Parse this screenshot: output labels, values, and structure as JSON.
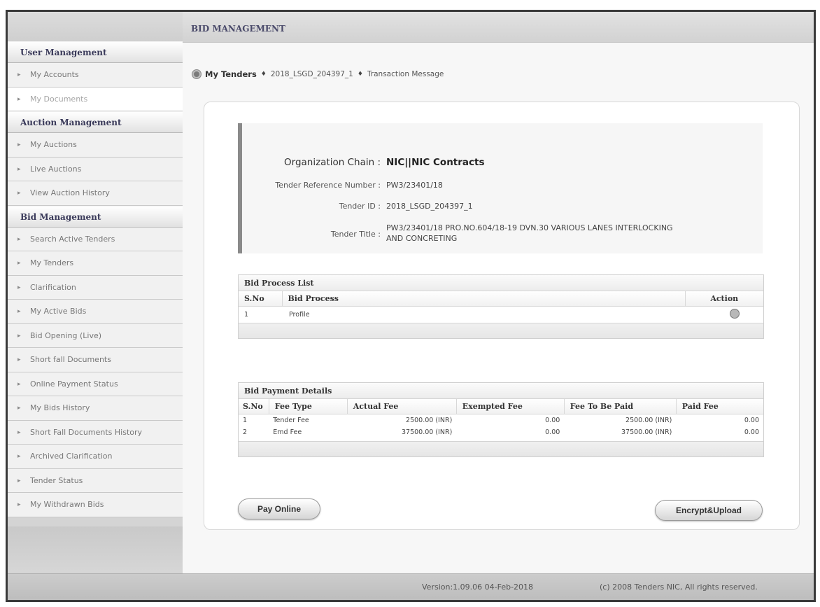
{
  "header": {
    "title": "BID MANAGEMENT"
  },
  "breadcrumb": {
    "home_icon": "home-circle-icon",
    "items": [
      "My Tenders",
      "2018_LSGD_204397_1",
      "Transaction Message"
    ],
    "separator": "♦"
  },
  "sidebar": {
    "sections": [
      {
        "title": "User Management",
        "items": [
          {
            "label": "My Accounts",
            "active": false
          },
          {
            "label": "My Documents",
            "active": true
          }
        ]
      },
      {
        "title": "Auction Management",
        "items": [
          {
            "label": "My Auctions"
          },
          {
            "label": "Live Auctions"
          },
          {
            "label": "View Auction History"
          }
        ]
      },
      {
        "title": "Bid Management",
        "items": [
          {
            "label": "Search Active Tenders"
          },
          {
            "label": "My Tenders"
          },
          {
            "label": "Clarification"
          },
          {
            "label": "My Active Bids"
          },
          {
            "label": "Bid Opening (Live)"
          },
          {
            "label": "Short fall Documents"
          },
          {
            "label": "Online Payment Status"
          },
          {
            "label": "My Bids History"
          },
          {
            "label": "Short Fall Documents History"
          },
          {
            "label": "Archived Clarification"
          },
          {
            "label": "Tender Status"
          },
          {
            "label": "My Withdrawn Bids"
          }
        ]
      }
    ]
  },
  "tender_info": {
    "org_label": "Organization Chain :",
    "org_value": "NIC||NIC Contracts",
    "ref_label": "Tender Reference Number :",
    "ref_value": "PW3/23401/18",
    "id_label": "Tender ID :",
    "id_value": "2018_LSGD_204397_1",
    "title_label": "Tender Title :",
    "title_value": "PW3/23401/18 PRO.NO.604/18-19 DVN.30 VARIOUS LANES INTERLOCKING AND CONCRETING"
  },
  "bid_process": {
    "title": "Bid Process List",
    "columns": [
      "S.No",
      "Bid Process",
      "Action"
    ],
    "rows": [
      {
        "sno": "1",
        "process": "Profile",
        "action_icon": "edit-action-icon"
      }
    ]
  },
  "bid_payment": {
    "title": "Bid Payment Details",
    "columns": [
      "S.No",
      "Fee Type",
      "Actual Fee",
      "Exempted Fee",
      "Fee To Be Paid",
      "Paid Fee"
    ],
    "rows": [
      {
        "sno": "1",
        "fee_type": "Tender Fee",
        "actual": "2500.00 (INR)",
        "exempted": "0.00",
        "to_pay": "2500.00 (INR)",
        "paid": "0.00"
      },
      {
        "sno": "2",
        "fee_type": "Emd Fee",
        "actual": "37500.00 (INR)",
        "exempted": "0.00",
        "to_pay": "37500.00 (INR)",
        "paid": "0.00"
      }
    ]
  },
  "buttons": {
    "pay_online": "Pay Online",
    "encrypt_upload": "Encrypt&Upload"
  },
  "footer": {
    "version": "Version:1.09.06 04-Feb-2018",
    "copyright": "(c) 2008 Tenders NIC, All rights reserved."
  }
}
